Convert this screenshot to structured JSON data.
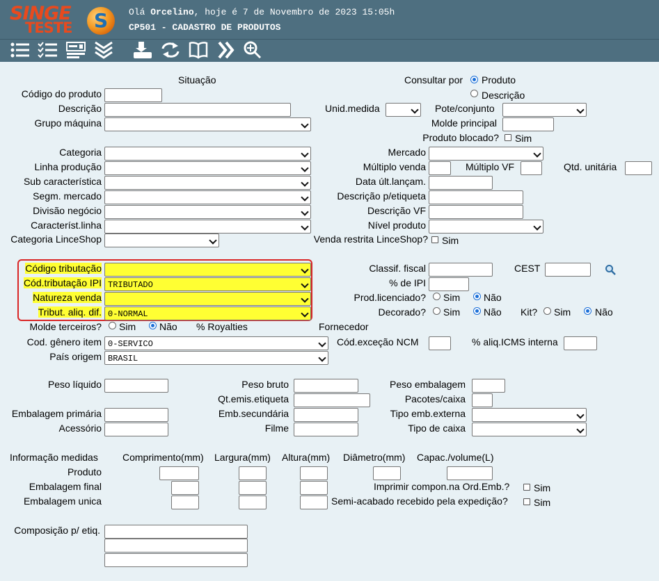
{
  "header": {
    "logo_top": "SINGE",
    "logo_bottom": "TESTE",
    "greeting_prefix": "Olá ",
    "user": "Orcelino",
    "greeting_suffix": ", hoje é 7 de Novembro de 2023 15:05h",
    "screen_title": "CP501 - CADASTRO DE PRODUTOS"
  },
  "toolbar": {
    "icons": [
      "list-icon",
      "checklist-icon",
      "form-icon",
      "chevrons-down-icon",
      "print-icon",
      "refresh-icon",
      "book-icon",
      "forward-icon",
      "zoom-icon"
    ]
  },
  "form": {
    "situacao": "Situação",
    "consultar_por": "Consultar por",
    "opt_produto": "Produto",
    "opt_descricao": "Descrição",
    "codigo_produto": "Código do produto",
    "descricao": "Descrição",
    "unid_medida": "Unid.medida",
    "pote_conjunto": "Pote/conjunto",
    "grupo_maquina": "Grupo máquina",
    "molde_principal": "Molde principal",
    "produto_blocado": "Produto blocado?",
    "sim": "Sim",
    "nao": "Não",
    "categoria": "Categoria",
    "mercado": "Mercado",
    "linha_producao": "Linha produção",
    "multiplo_venda": "Múltiplo venda",
    "multiplo_vf": "Múltiplo VF",
    "qtd_unitaria": "Qtd. unitária",
    "sub_caracteristica": "Sub característica",
    "data_ult_lancam": "Data últ.lançam.",
    "segm_mercado": "Segm. mercado",
    "descricao_etiqueta": "Descrição p/etiqueta",
    "divisao_negocio": "Divisão negócio",
    "descricao_vf": "Descrição VF",
    "caracterist_linha": "Característ.linha",
    "nivel_produto": "Nível produto",
    "categoria_linceshop": "Categoria LinceShop",
    "venda_restrita": "Venda restrita LinceShop?",
    "codigo_tributacao": "Código tributação",
    "classif_fiscal": "Classif. fiscal",
    "cest": "CEST",
    "cod_tributacao_ipi": "Cód.tributação IPI",
    "cod_tributacao_ipi_value": "TRIBUTADO",
    "perc_ipi": "% de IPI",
    "natureza_venda": "Natureza venda",
    "prod_licenciado": "Prod.licenciado?",
    "tribut_aliq_dif": "Tribut. aliq. dif.",
    "tribut_aliq_dif_value": "0-NORMAL",
    "decorado": "Decorado?",
    "kit": "Kit?",
    "molde_terceiros": "Molde terceiros?",
    "royalties": "% Royalties",
    "fornecedor": "Fornecedor",
    "cod_genero_item": "Cod. gênero item",
    "cod_genero_item_value": "0-SERVICO",
    "cod_excecao_ncm": "Cód.exceção NCM",
    "aliq_icms_interna": "% aliq.ICMS interna",
    "pais_origem": "País origem",
    "pais_origem_value": "BRASIL",
    "peso_liquido": "Peso líquido",
    "peso_bruto": "Peso bruto",
    "peso_embalagem": "Peso embalagem",
    "qt_emis_etiqueta": "Qt.emis.etiqueta",
    "pacotes_caixa": "Pacotes/caixa",
    "embalagem_primaria": "Embalagem primária",
    "emb_secundaria": "Emb.secundária",
    "tipo_emb_externa": "Tipo emb.externa",
    "acessorio": "Acessório",
    "filme": "Filme",
    "tipo_de_caixa": "Tipo de caixa",
    "informacao_medidas": "Informação medidas",
    "comprimento": "Comprimento(mm)",
    "largura": "Largura(mm)",
    "altura": "Altura(mm)",
    "diametro": "Diâmetro(mm)",
    "capac_volume": "Capac./volume(L)",
    "produto": "Produto",
    "embalagem_final": "Embalagem final",
    "embalagem_unica": "Embalagem unica",
    "imprimir_compon": "Imprimir compon.na Ord.Emb.?",
    "semi_acabado": "Semi-acabado recebido pela expedição?",
    "composicao_etiq": "Composição p/ etiq."
  },
  "state": {
    "consultar_por": "Produto",
    "prod_licenciado": "Não",
    "decorado": "Não",
    "kit": "Não",
    "molde_terceiros": "Não"
  },
  "colors": {
    "header_bg": "#4e6f80",
    "page_bg": "#e8f1f5",
    "highlight": "#ffff33",
    "highlight_border": "#d92525",
    "logo": "#e84a1e"
  }
}
